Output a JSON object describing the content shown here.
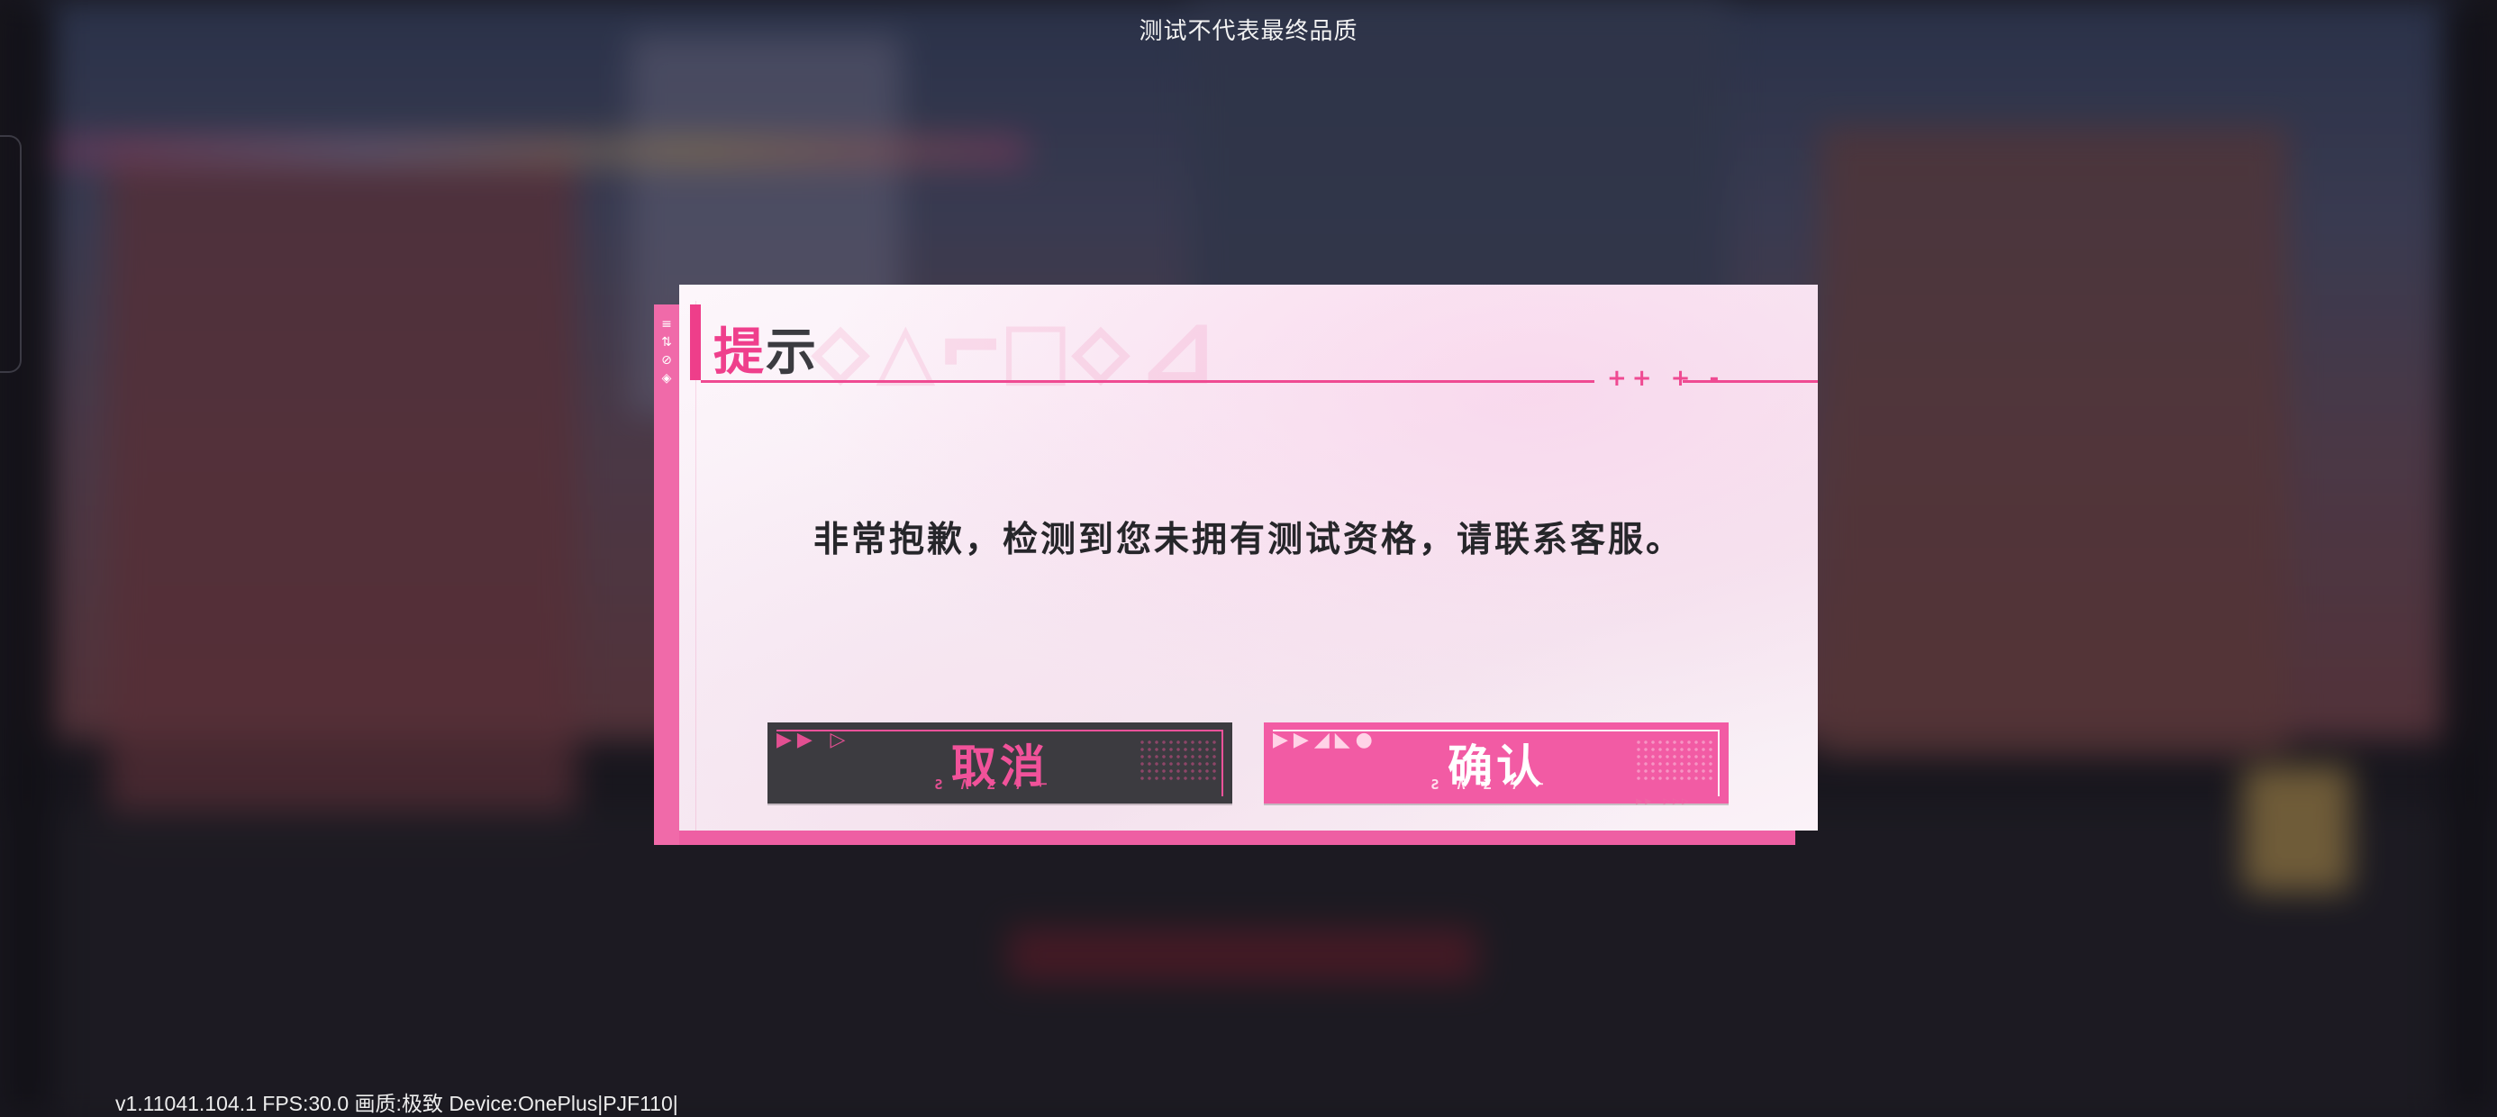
{
  "watermark": "测试不代表最终品质",
  "dialog": {
    "title_accent": "提",
    "title_rest": "示",
    "message": "非常抱歉，检测到您未拥有测试资格，请联系客服。",
    "buttons": {
      "cancel": "取消",
      "confirm": "确认"
    },
    "colors": {
      "accent": "#ef3f8c",
      "cancel_bg": "#3c3b40",
      "confirm_bg": "#f25ba4"
    }
  },
  "status_bar": "v1.11041.104.1 FPS:30.0 画质:极致 Device:OnePlus|PJF110|"
}
